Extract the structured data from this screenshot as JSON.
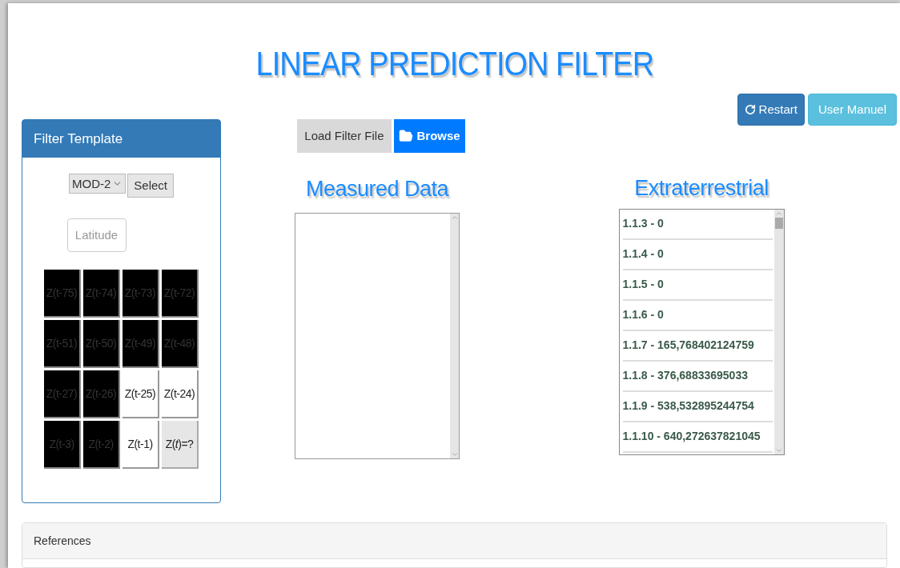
{
  "title": "LINEAR PREDICTION FILTER",
  "header_buttons": [
    {
      "label": "Restart",
      "kind": "restart"
    },
    {
      "label": "User Manuel",
      "kind": "manual"
    }
  ],
  "filter_template": {
    "title": "Filter Template",
    "model_select": {
      "value": "MOD-2"
    },
    "select_button": "Select",
    "latitude_button": "Latitude",
    "cells": [
      {
        "label": "Z(t-75)",
        "kind": "tap",
        "selected": false
      },
      {
        "label": "Z(t-74)",
        "kind": "tap",
        "selected": false
      },
      {
        "label": "Z(t-73)",
        "kind": "tap",
        "selected": false
      },
      {
        "label": "Z(t-72)",
        "kind": "tap",
        "selected": false
      },
      {
        "label": "Z(t-51)",
        "kind": "tap",
        "selected": false
      },
      {
        "label": "Z(t-50)",
        "kind": "tap",
        "selected": false
      },
      {
        "label": "Z(t-49)",
        "kind": "tap",
        "selected": false
      },
      {
        "label": "Z(t-48)",
        "kind": "tap",
        "selected": false
      },
      {
        "label": "Z(t-27)",
        "kind": "tap",
        "selected": false
      },
      {
        "label": "Z(t-26)",
        "kind": "tap",
        "selected": false
      },
      {
        "label": "Z(t-25)",
        "kind": "tap",
        "selected": true
      },
      {
        "label": "Z(t-24)",
        "kind": "tap",
        "selected": true
      },
      {
        "label": "Z(t-3)",
        "kind": "tap",
        "selected": false
      },
      {
        "label": "Z(t-2)",
        "kind": "tap",
        "selected": false
      },
      {
        "label": "Z(t-1)",
        "kind": "tap",
        "selected": true
      },
      {
        "label": "Z(*t*)=?",
        "kind": "target",
        "selected": false
      }
    ]
  },
  "file_loader": {
    "label": "Load Filter File",
    "browse_button": "Browse"
  },
  "measured_data": {
    "title": "Measured Data"
  },
  "extraterrestrial": {
    "title": "Extraterrestrial",
    "items": [
      "1.1.3 - 0",
      "1.1.4 - 0",
      "1.1.5 - 0",
      "1.1.6 - 0",
      "1.1.7 - 165,768402124759",
      "1.1.8 - 376,68833695033",
      "1.1.9 - 538,532895244754",
      "1.1.10 - 640,272637821045"
    ]
  },
  "references": {
    "title": "References"
  }
}
